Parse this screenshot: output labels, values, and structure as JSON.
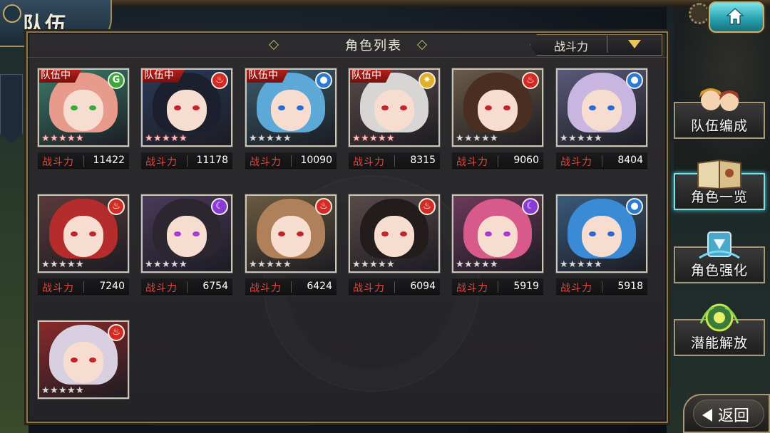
{
  "header": {
    "title": "队伍"
  },
  "list": {
    "title": "角色列表",
    "sort_label": "战斗力",
    "power_label": "战斗力",
    "party_tag": "队伍中"
  },
  "characters": [
    {
      "power": "11422",
      "in_party": true,
      "element": "wind",
      "stars": 5,
      "hair": "#e89a8c",
      "bg": "#3a7a6a"
    },
    {
      "power": "11178",
      "in_party": true,
      "element": "fire",
      "stars": 5,
      "hair": "#1b1f2e",
      "bg": "#2a3a5a"
    },
    {
      "power": "10090",
      "in_party": true,
      "element": "water",
      "stars": 0,
      "hair": "#5ca8d6",
      "bg": "#3a5a6a"
    },
    {
      "power": "8315",
      "in_party": true,
      "element": "light",
      "stars": 5,
      "hair": "#d8d6d4",
      "bg": "#5a4a4a"
    },
    {
      "power": "9060",
      "in_party": false,
      "element": "fire",
      "stars": 0,
      "hair": "#4a2e22",
      "bg": "#6a5a48"
    },
    {
      "power": "8404",
      "in_party": false,
      "element": "water",
      "stars": 0,
      "hair": "#c9b6e0",
      "bg": "#5a5a7a"
    },
    {
      "power": "7240",
      "in_party": false,
      "element": "fire",
      "stars": 0,
      "hair": "#b42c2c",
      "bg": "#5a3a3a"
    },
    {
      "power": "6754",
      "in_party": false,
      "element": "dark",
      "stars": 0,
      "hair": "#2c2630",
      "bg": "#4a3a5a"
    },
    {
      "power": "6424",
      "in_party": false,
      "element": "fire",
      "stars": 0,
      "hair": "#b0805a",
      "bg": "#6a5a40"
    },
    {
      "power": "6094",
      "in_party": false,
      "element": "fire",
      "stars": 0,
      "hair": "#221c1c",
      "bg": "#5a4a4a"
    },
    {
      "power": "5919",
      "in_party": false,
      "element": "dark",
      "stars": 0,
      "hair": "#d85a8a",
      "bg": "#6a3a5a"
    },
    {
      "power": "5918",
      "in_party": false,
      "element": "water",
      "stars": 0,
      "hair": "#3a8ad6",
      "bg": "#3a5a7a"
    },
    {
      "power": "",
      "in_party": false,
      "element": "fire",
      "stars": 0,
      "hair": "#d8d0e0",
      "bg": "#8a2a2a"
    }
  ],
  "element_icons": {
    "wind": {
      "glyph": "G",
      "color": "#3aa83a"
    },
    "fire": {
      "glyph": "♨",
      "color": "#d42a24"
    },
    "water": {
      "glyph": "●",
      "color": "#2a7ad6"
    },
    "light": {
      "glyph": "✷",
      "color": "#e0b02a"
    },
    "dark": {
      "glyph": "☾",
      "color": "#8a3ad6"
    }
  },
  "side_menu": [
    {
      "label": "队伍编成",
      "active": false
    },
    {
      "label": "角色一览",
      "active": true
    },
    {
      "label": "角色强化",
      "active": false
    },
    {
      "label": "潜能解放",
      "active": false
    }
  ],
  "back_label": "返回"
}
